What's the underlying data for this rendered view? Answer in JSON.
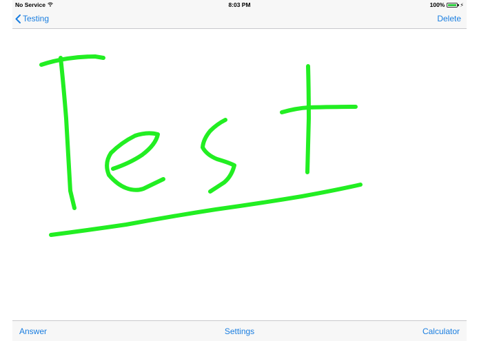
{
  "status_bar": {
    "carrier": "No Service",
    "time": "8:03 PM",
    "battery": "100%",
    "battery_level": 1.0
  },
  "nav_bar": {
    "back_label": "Testing",
    "action_label": "Delete"
  },
  "canvas": {
    "stroke_color": "#22ee22",
    "handwritten_text": "Test"
  },
  "toolbar": {
    "left_label": "Answer",
    "center_label": "Settings",
    "right_label": "Calculator"
  },
  "colors": {
    "accent": "#1a7ee0",
    "bar_background": "#f7f7f7"
  }
}
